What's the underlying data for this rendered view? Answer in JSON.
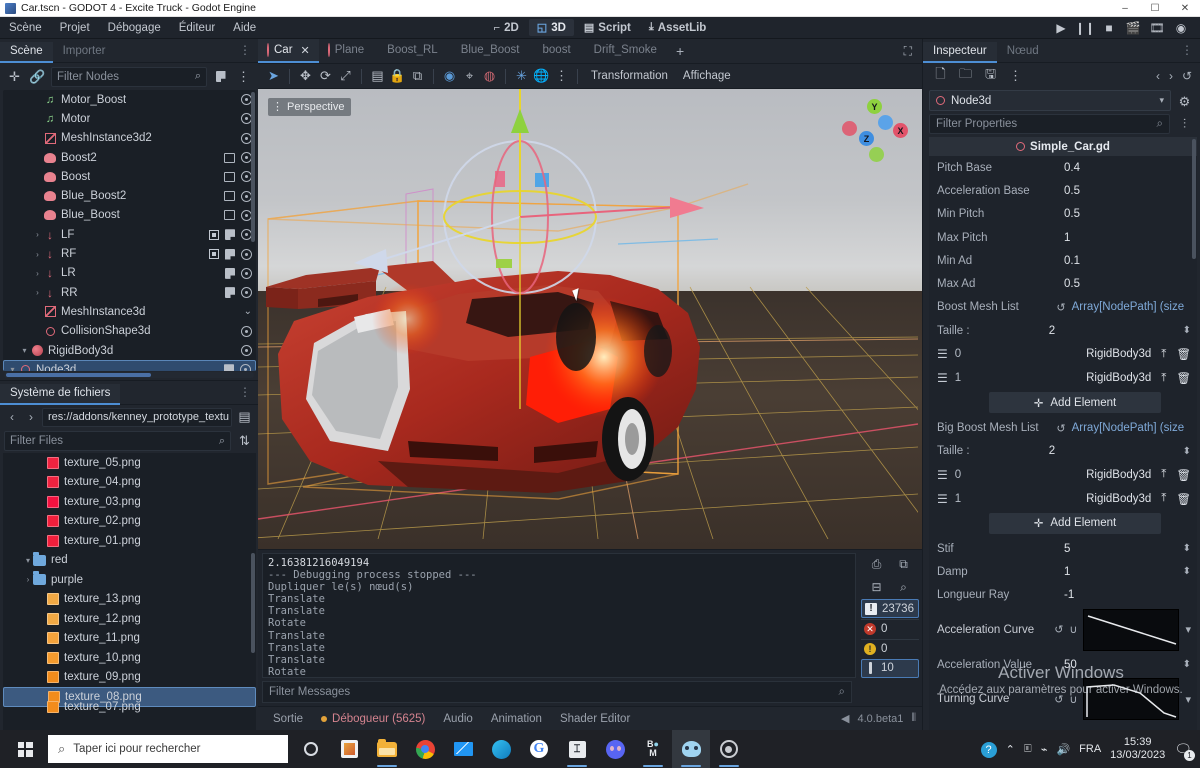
{
  "window": {
    "title": "Car.tscn - GODOT 4 - Excite Truck - Godot Engine",
    "minimize": "–",
    "maximize": "☐",
    "close": "✕"
  },
  "menubar": {
    "items": [
      "Scène",
      "Projet",
      "Débogage",
      "Éditeur",
      "Aide"
    ],
    "main_buttons": [
      {
        "label": "2D",
        "icon": "2d-icon",
        "active": false
      },
      {
        "label": "3D",
        "icon": "3d-icon",
        "active": true
      },
      {
        "label": "Script",
        "icon": "script-icon",
        "active": false
      },
      {
        "label": "AssetLib",
        "icon": "assetlib-icon",
        "active": false
      }
    ],
    "play_controls": [
      "play-icon",
      "pause-icon",
      "stop-icon",
      "play-scene-icon",
      "play-custom-icon",
      "movie-icon"
    ]
  },
  "scene_panel": {
    "tabs": [
      {
        "label": "Scène",
        "active": true
      },
      {
        "label": "Importer",
        "active": false
      }
    ],
    "toolbar": [
      "add-node-icon",
      "link-node-icon"
    ],
    "filter_placeholder": "Filter Nodes",
    "nodes": [
      {
        "label": "Node3d",
        "depth": 0,
        "icon": "node3d-icon",
        "arrow": "▾",
        "selected": true,
        "script": true,
        "visible": true
      },
      {
        "label": "RigidBody3d",
        "depth": 1,
        "icon": "rigidbody-icon",
        "arrow": "▾",
        "selected": false,
        "script": false,
        "visible": true
      },
      {
        "label": "CollisionShape3d",
        "depth": 2,
        "icon": "collisionshape-icon",
        "arrow": "",
        "selected": false,
        "script": false,
        "visible": true
      },
      {
        "label": "MeshInstance3d",
        "depth": 2,
        "icon": "mesh-icon",
        "arrow": "",
        "selected": false,
        "script": false,
        "visible": false
      },
      {
        "label": "RR",
        "depth": 2,
        "icon": "raycast-icon",
        "arrow": "›",
        "selected": false,
        "script": true,
        "visible": true
      },
      {
        "label": "LR",
        "depth": 2,
        "icon": "raycast-icon",
        "arrow": "›",
        "selected": false,
        "script": true,
        "visible": true
      },
      {
        "label": "RF",
        "depth": 2,
        "icon": "raycast-icon",
        "arrow": "›",
        "selected": false,
        "script": true,
        "visible": true,
        "extra": true
      },
      {
        "label": "LF",
        "depth": 2,
        "icon": "raycast-icon",
        "arrow": "›",
        "selected": false,
        "script": true,
        "visible": true,
        "extra": true
      },
      {
        "label": "Blue_Boost",
        "depth": 2,
        "icon": "particles-icon",
        "arrow": "",
        "selected": false,
        "anim": true,
        "visible": true
      },
      {
        "label": "Blue_Boost2",
        "depth": 2,
        "icon": "particles-icon",
        "arrow": "",
        "selected": false,
        "anim": true,
        "visible": true
      },
      {
        "label": "Boost",
        "depth": 2,
        "icon": "particles-icon",
        "arrow": "",
        "selected": false,
        "anim": true,
        "visible": true
      },
      {
        "label": "Boost2",
        "depth": 2,
        "icon": "particles-icon",
        "arrow": "",
        "selected": false,
        "anim": true,
        "visible": true
      },
      {
        "label": "MeshInstance3d2",
        "depth": 2,
        "icon": "mesh-icon",
        "arrow": "",
        "selected": false,
        "visible": true
      },
      {
        "label": "Motor",
        "depth": 2,
        "icon": "audio-icon",
        "arrow": "",
        "selected": false,
        "visible": true
      },
      {
        "label": "Motor_Boost",
        "depth": 2,
        "icon": "audio-icon",
        "arrow": "",
        "selected": false,
        "visible": true
      }
    ]
  },
  "filesystem_panel": {
    "tab_label": "Système de fichiers",
    "path": "res://addons/kenney_prototype_textu",
    "filter_placeholder": "Filter Files",
    "files": [
      {
        "label": "texture_07.png",
        "type": "file",
        "color": "#f28c1c",
        "depth": 2,
        "selected": false,
        "partial": true
      },
      {
        "label": "texture_08.png",
        "type": "file",
        "color": "#f28c1c",
        "depth": 2,
        "selected": true
      },
      {
        "label": "texture_09.png",
        "type": "file",
        "color": "#f28c1c",
        "depth": 2,
        "selected": false
      },
      {
        "label": "texture_10.png",
        "type": "file",
        "color": "#f59b2e",
        "depth": 2,
        "selected": false
      },
      {
        "label": "texture_11.png",
        "type": "file",
        "color": "#f5a33c",
        "depth": 2,
        "selected": false
      },
      {
        "label": "texture_12.png",
        "type": "file",
        "color": "#f0a844",
        "depth": 2,
        "selected": false
      },
      {
        "label": "texture_13.png",
        "type": "file",
        "color": "#f0a844",
        "depth": 2,
        "selected": false
      },
      {
        "label": "purple",
        "type": "folder",
        "depth": 1,
        "arrow": "›",
        "selected": false
      },
      {
        "label": "red",
        "type": "folder",
        "depth": 1,
        "arrow": "▾",
        "selected": false
      },
      {
        "label": "texture_01.png",
        "type": "file",
        "color": "#f01f3c",
        "depth": 2,
        "selected": false
      },
      {
        "label": "texture_02.png",
        "type": "file",
        "color": "#f01f3c",
        "depth": 2,
        "selected": false
      },
      {
        "label": "texture_03.png",
        "type": "file",
        "color": "#f21240",
        "depth": 2,
        "selected": false
      },
      {
        "label": "texture_04.png",
        "type": "file",
        "color": "#ef2340",
        "depth": 2,
        "selected": false
      },
      {
        "label": "texture_05.png",
        "type": "file",
        "color": "#ef2340",
        "depth": 2,
        "selected": false
      }
    ]
  },
  "scene_tabs": {
    "tabs": [
      {
        "label": "Car",
        "icon": "node3d-icon",
        "active": true,
        "closable": true
      },
      {
        "label": "Plane",
        "icon": "node3d-icon",
        "active": false
      },
      {
        "label": "Boost_RL",
        "icon": "particles-icon",
        "active": false
      },
      {
        "label": "Blue_Boost",
        "icon": "particles-icon",
        "active": false
      },
      {
        "label": "boost",
        "icon": "particles-icon",
        "active": false
      },
      {
        "label": "Drift_Smoke",
        "icon": "particles-icon",
        "active": false
      }
    ],
    "add_label": "+",
    "expand_icon": "fullscreen-icon"
  },
  "viewport_toolbar": {
    "tools": [
      "select-icon",
      "move-icon",
      "rotate-icon",
      "scale-icon",
      "list-icon",
      "lock-icon",
      "group-icon",
      "ruler-icon",
      "snap-icon",
      "light-icon",
      "sun-icon",
      "environment-icon",
      "more-icon"
    ],
    "menus": [
      "Transformation",
      "Affichage"
    ]
  },
  "viewport": {
    "perspective_label": "Perspective",
    "gizmo_axes": [
      {
        "label": "Y",
        "color": "#8ed13f"
      },
      {
        "label": "X",
        "color": "#e2536a"
      },
      {
        "label": "Z",
        "color": "#3f8ee0"
      }
    ]
  },
  "output": {
    "lines": [
      "2.16381216049194",
      "--- Debugging process stopped ---",
      "Dupliquer le(s) nœud(s)",
      "Translate",
      "Translate",
      "Rotate",
      "Translate",
      "Translate",
      "Translate",
      "Rotate"
    ],
    "side_buttons": [
      "clear-icon",
      "copy-icon",
      "collapse-icon",
      "search-icon"
    ],
    "counters": [
      {
        "type": "message",
        "value": "23736",
        "highlighted": true
      },
      {
        "type": "error",
        "value": "0",
        "highlighted": false
      },
      {
        "type": "warning",
        "value": "0",
        "highlighted": false
      },
      {
        "type": "info",
        "value": "10",
        "highlighted": true
      }
    ],
    "filter_placeholder": "Filter Messages"
  },
  "bottom_bar": {
    "tabs": [
      {
        "label": "Sortie",
        "active": false,
        "dot": false
      },
      {
        "label": "Débogueur (5625)",
        "active": true,
        "dot": true
      },
      {
        "label": "Audio",
        "active": false,
        "dot": false
      },
      {
        "label": "Animation",
        "active": false,
        "dot": false
      },
      {
        "label": "Shader Editor",
        "active": false,
        "dot": false
      }
    ],
    "version": "4.0.beta1"
  },
  "inspector": {
    "tabs": [
      {
        "label": "Inspecteur",
        "active": true
      },
      {
        "label": "Nœud",
        "active": false
      }
    ],
    "toolbar": [
      "new-resource-icon",
      "open-resource-icon",
      "save-resource-icon",
      "more-icon"
    ],
    "nav": [
      "back-icon",
      "forward-icon",
      "history-icon"
    ],
    "node_name": "Node3d",
    "doc_icon": "open-docs-icon",
    "filter_placeholder": "Filter Properties",
    "settings_icon": "object-menu-icon",
    "script_name": "Simple_Car.gd",
    "properties": [
      {
        "name": "Pitch Base",
        "value": "0.4",
        "kind": "text"
      },
      {
        "name": "Acceleration Base",
        "value": "0.5",
        "kind": "text"
      },
      {
        "name": "Min Pitch",
        "value": "0.5",
        "kind": "text"
      },
      {
        "name": "Max Pitch",
        "value": "1",
        "kind": "text"
      },
      {
        "name": "Min Ad",
        "value": "0.1",
        "kind": "text"
      },
      {
        "name": "Max Ad",
        "value": "0.5",
        "kind": "text"
      },
      {
        "name": "Boost Mesh List",
        "value": "Array[NodePath] (size",
        "kind": "array_header",
        "revert": true
      },
      {
        "name": "Taille :",
        "value": "2",
        "kind": "size"
      },
      {
        "index": "0",
        "value": "RigidBody3d",
        "kind": "array_item"
      },
      {
        "index": "1",
        "value": "RigidBody3d",
        "kind": "array_item"
      },
      {
        "name": "Add Element",
        "kind": "add_button"
      },
      {
        "name": "Big Boost Mesh List",
        "value": "Array[NodePath] (size",
        "kind": "array_header",
        "revert": true
      },
      {
        "name": "Taille :",
        "value": "2",
        "kind": "size"
      },
      {
        "index": "0",
        "value": "RigidBody3d",
        "kind": "array_item"
      },
      {
        "index": "1",
        "value": "RigidBody3d",
        "kind": "array_item"
      },
      {
        "name": "Add Element",
        "kind": "add_button"
      },
      {
        "name": "Stif",
        "value": "5",
        "kind": "spin"
      },
      {
        "name": "Damp",
        "value": "1",
        "kind": "spin"
      },
      {
        "name": "Longueur Ray",
        "value": "-1",
        "kind": "text"
      },
      {
        "name": "Acceleration Curve",
        "value": "",
        "kind": "curve",
        "curve": "descending"
      },
      {
        "name": "Acceleration Value",
        "value": "50",
        "kind": "spin"
      },
      {
        "name": "Turning Curve",
        "value": "",
        "kind": "curve",
        "curve": "peak"
      }
    ]
  },
  "watermark": {
    "line1": "Activer Windows",
    "line2": "Accédez aux paramètres pour activer Windows."
  },
  "taskbar": {
    "search_placeholder": "Taper ici pour rechercher",
    "icons": [
      "cortana-icon",
      "store-icon",
      "explorer-icon",
      "chrome-icon",
      "mail-icon",
      "edge-icon",
      "google-icon",
      "editor-icon",
      "discord-icon",
      "bm-icon",
      "godot-icon",
      "blender-icon"
    ],
    "tray": [
      "help-icon",
      "chevron-up-icon",
      "battery-icon",
      "wifi-icon",
      "volume-icon"
    ],
    "language": "FRA",
    "time": "15:39",
    "date": "13/03/2023",
    "notifications": "1"
  }
}
